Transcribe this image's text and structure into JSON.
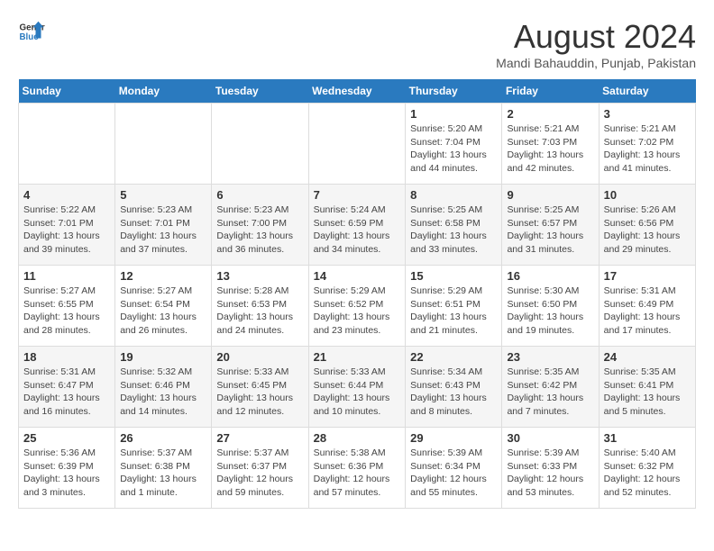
{
  "header": {
    "logo_line1": "General",
    "logo_line2": "Blue",
    "month_year": "August 2024",
    "location": "Mandi Bahauddin, Punjab, Pakistan"
  },
  "weekdays": [
    "Sunday",
    "Monday",
    "Tuesday",
    "Wednesday",
    "Thursday",
    "Friday",
    "Saturday"
  ],
  "weeks": [
    [
      {
        "day": "",
        "info": ""
      },
      {
        "day": "",
        "info": ""
      },
      {
        "day": "",
        "info": ""
      },
      {
        "day": "",
        "info": ""
      },
      {
        "day": "1",
        "info": "Sunrise: 5:20 AM\nSunset: 7:04 PM\nDaylight: 13 hours\nand 44 minutes."
      },
      {
        "day": "2",
        "info": "Sunrise: 5:21 AM\nSunset: 7:03 PM\nDaylight: 13 hours\nand 42 minutes."
      },
      {
        "day": "3",
        "info": "Sunrise: 5:21 AM\nSunset: 7:02 PM\nDaylight: 13 hours\nand 41 minutes."
      }
    ],
    [
      {
        "day": "4",
        "info": "Sunrise: 5:22 AM\nSunset: 7:01 PM\nDaylight: 13 hours\nand 39 minutes."
      },
      {
        "day": "5",
        "info": "Sunrise: 5:23 AM\nSunset: 7:01 PM\nDaylight: 13 hours\nand 37 minutes."
      },
      {
        "day": "6",
        "info": "Sunrise: 5:23 AM\nSunset: 7:00 PM\nDaylight: 13 hours\nand 36 minutes."
      },
      {
        "day": "7",
        "info": "Sunrise: 5:24 AM\nSunset: 6:59 PM\nDaylight: 13 hours\nand 34 minutes."
      },
      {
        "day": "8",
        "info": "Sunrise: 5:25 AM\nSunset: 6:58 PM\nDaylight: 13 hours\nand 33 minutes."
      },
      {
        "day": "9",
        "info": "Sunrise: 5:25 AM\nSunset: 6:57 PM\nDaylight: 13 hours\nand 31 minutes."
      },
      {
        "day": "10",
        "info": "Sunrise: 5:26 AM\nSunset: 6:56 PM\nDaylight: 13 hours\nand 29 minutes."
      }
    ],
    [
      {
        "day": "11",
        "info": "Sunrise: 5:27 AM\nSunset: 6:55 PM\nDaylight: 13 hours\nand 28 minutes."
      },
      {
        "day": "12",
        "info": "Sunrise: 5:27 AM\nSunset: 6:54 PM\nDaylight: 13 hours\nand 26 minutes."
      },
      {
        "day": "13",
        "info": "Sunrise: 5:28 AM\nSunset: 6:53 PM\nDaylight: 13 hours\nand 24 minutes."
      },
      {
        "day": "14",
        "info": "Sunrise: 5:29 AM\nSunset: 6:52 PM\nDaylight: 13 hours\nand 23 minutes."
      },
      {
        "day": "15",
        "info": "Sunrise: 5:29 AM\nSunset: 6:51 PM\nDaylight: 13 hours\nand 21 minutes."
      },
      {
        "day": "16",
        "info": "Sunrise: 5:30 AM\nSunset: 6:50 PM\nDaylight: 13 hours\nand 19 minutes."
      },
      {
        "day": "17",
        "info": "Sunrise: 5:31 AM\nSunset: 6:49 PM\nDaylight: 13 hours\nand 17 minutes."
      }
    ],
    [
      {
        "day": "18",
        "info": "Sunrise: 5:31 AM\nSunset: 6:47 PM\nDaylight: 13 hours\nand 16 minutes."
      },
      {
        "day": "19",
        "info": "Sunrise: 5:32 AM\nSunset: 6:46 PM\nDaylight: 13 hours\nand 14 minutes."
      },
      {
        "day": "20",
        "info": "Sunrise: 5:33 AM\nSunset: 6:45 PM\nDaylight: 13 hours\nand 12 minutes."
      },
      {
        "day": "21",
        "info": "Sunrise: 5:33 AM\nSunset: 6:44 PM\nDaylight: 13 hours\nand 10 minutes."
      },
      {
        "day": "22",
        "info": "Sunrise: 5:34 AM\nSunset: 6:43 PM\nDaylight: 13 hours\nand 8 minutes."
      },
      {
        "day": "23",
        "info": "Sunrise: 5:35 AM\nSunset: 6:42 PM\nDaylight: 13 hours\nand 7 minutes."
      },
      {
        "day": "24",
        "info": "Sunrise: 5:35 AM\nSunset: 6:41 PM\nDaylight: 13 hours\nand 5 minutes."
      }
    ],
    [
      {
        "day": "25",
        "info": "Sunrise: 5:36 AM\nSunset: 6:39 PM\nDaylight: 13 hours\nand 3 minutes."
      },
      {
        "day": "26",
        "info": "Sunrise: 5:37 AM\nSunset: 6:38 PM\nDaylight: 13 hours\nand 1 minute."
      },
      {
        "day": "27",
        "info": "Sunrise: 5:37 AM\nSunset: 6:37 PM\nDaylight: 12 hours\nand 59 minutes."
      },
      {
        "day": "28",
        "info": "Sunrise: 5:38 AM\nSunset: 6:36 PM\nDaylight: 12 hours\nand 57 minutes."
      },
      {
        "day": "29",
        "info": "Sunrise: 5:39 AM\nSunset: 6:34 PM\nDaylight: 12 hours\nand 55 minutes."
      },
      {
        "day": "30",
        "info": "Sunrise: 5:39 AM\nSunset: 6:33 PM\nDaylight: 12 hours\nand 53 minutes."
      },
      {
        "day": "31",
        "info": "Sunrise: 5:40 AM\nSunset: 6:32 PM\nDaylight: 12 hours\nand 52 minutes."
      }
    ]
  ]
}
